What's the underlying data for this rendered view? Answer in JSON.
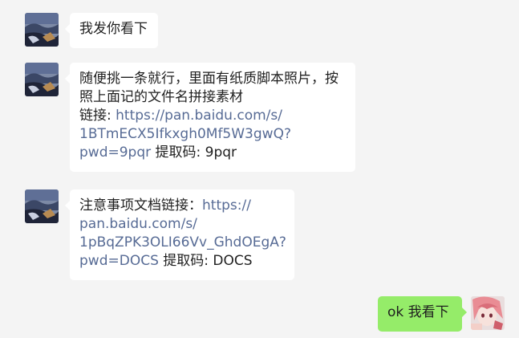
{
  "conversation": {
    "messages": [
      {
        "sender": "other",
        "lines": [
          "我发你看下"
        ]
      },
      {
        "sender": "other",
        "line1": "随便挑一条就行，里面有纸质脚本照片，按",
        "line2": "照上面记的文件名拼接素材",
        "link_prefix": "链接: ",
        "link_line1": "https://pan.baidu.com/s/",
        "link_line2": "1BTmECX5Ifkxgh0Mf5W3gwQ?",
        "link_line3": "pwd=9pqr",
        "code_text": " 提取码: 9pqr"
      },
      {
        "sender": "other",
        "prefix": "注意事项文档链接：",
        "link_line1": "https://",
        "link_line2": "pan.baidu.com/s/",
        "link_line3": "1pBqZPK3OLI66Vv_GhdOEgA?",
        "link_line4": "pwd=DOCS",
        "code_text": " 提取码: DOCS"
      },
      {
        "sender": "self",
        "text": "ok 我看下"
      }
    ]
  },
  "colors": {
    "background": "#f4f4f4",
    "bubble_other": "#ffffff",
    "bubble_self": "#95ec69",
    "link": "#576b95"
  },
  "icons": {
    "other_avatar": "landscape-avatar-icon",
    "self_avatar": "anime-girl-avatar-icon"
  }
}
